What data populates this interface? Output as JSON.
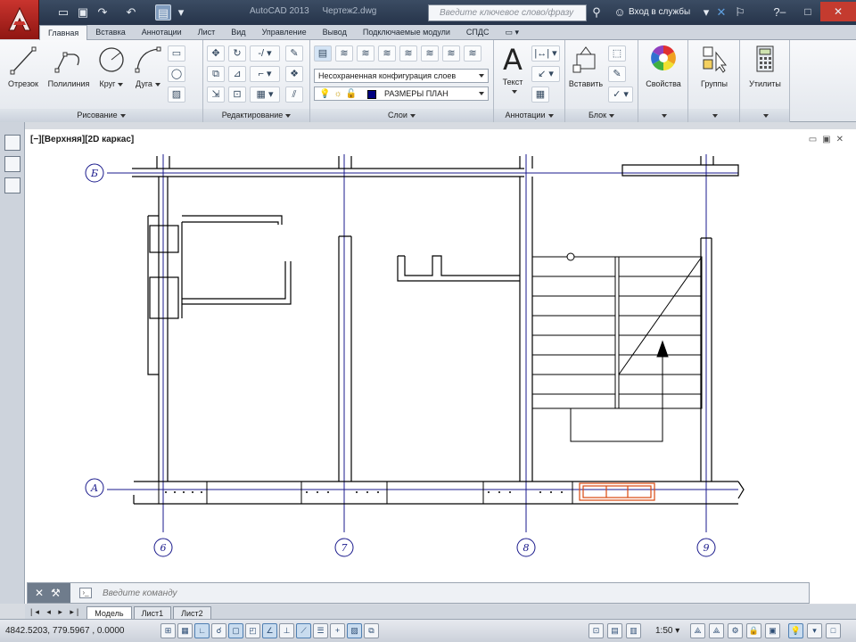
{
  "title_bar": {
    "app_name": "AutoCAD 2013",
    "file_name": "Чертеж2.dwg",
    "search_placeholder": "Введите ключевое слово/фразу",
    "login_label": "Вход в службы"
  },
  "ribbon_tabs": [
    {
      "label": "Главная",
      "active": true
    },
    {
      "label": "Вставка"
    },
    {
      "label": "Аннотации"
    },
    {
      "label": "Лист"
    },
    {
      "label": "Вид"
    },
    {
      "label": "Управление"
    },
    {
      "label": "Вывод"
    },
    {
      "label": "Подключаемые модули"
    },
    {
      "label": "СПДС"
    }
  ],
  "ribbon": {
    "draw": {
      "title": "Рисование",
      "tools": [
        "Отрезок",
        "Полилиния",
        "Круг",
        "Дуга"
      ]
    },
    "modify": {
      "title": "Редактирование"
    },
    "layers": {
      "title": "Слои",
      "layer_state": "Несохраненная конфигурация слоев",
      "current_layer": "РАЗМЕРЫ ПЛАН",
      "layer_color": "#000080"
    },
    "annotation": {
      "title": "Аннотации",
      "text_tool": "Текст"
    },
    "block": {
      "title": "Блок",
      "insert_tool": "Вставить"
    },
    "properties": {
      "label": "Свойства"
    },
    "groups": {
      "label": "Группы"
    },
    "utilities": {
      "label": "Утилиты"
    }
  },
  "viewport": {
    "label": "[−][Верхняя][2D каркас]"
  },
  "grid_axes": {
    "rows": [
      "Б",
      "А"
    ],
    "columns": [
      "6",
      "7",
      "8",
      "9"
    ]
  },
  "command_line": {
    "placeholder": "Введите команду"
  },
  "layout_tabs": [
    {
      "label": "Модель",
      "active": true
    },
    {
      "label": "Лист1"
    },
    {
      "label": "Лист2"
    }
  ],
  "status_bar": {
    "coordinates": "4842.5203, 779.5967 , 0.0000",
    "annotation_scale": "1:50"
  },
  "colors": {
    "axis_line": "#1a1a8c",
    "wall_line": "#000000",
    "selection": "#d9480f",
    "title_bar": "#2f3e54"
  },
  "icons": [
    "app-logo-icon",
    "new-icon",
    "open-icon",
    "save-icon",
    "undo-icon",
    "redo-icon",
    "search-icon",
    "binoculars-icon",
    "help-icon"
  ]
}
